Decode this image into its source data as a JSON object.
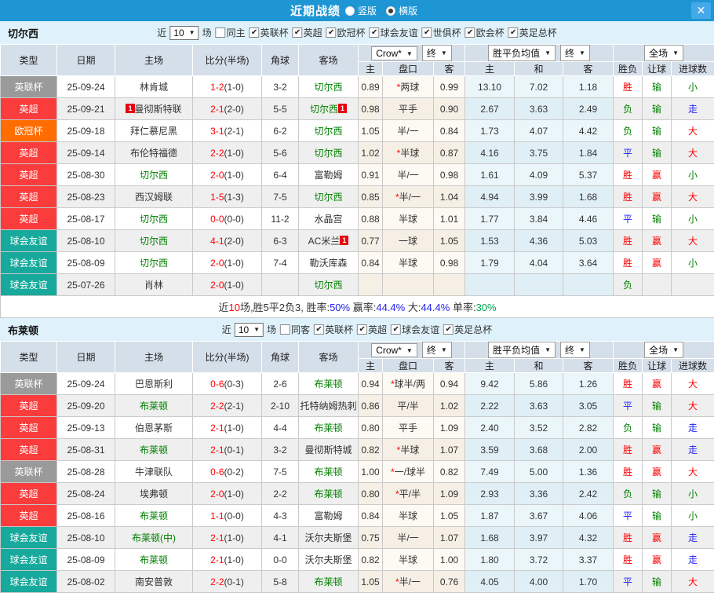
{
  "titlebar": {
    "title": "近期战绩",
    "radio_vertical": "竖版",
    "radio_horizontal": "横版",
    "selected_layout": "横版",
    "close_label": "X"
  },
  "colors": {
    "titlebar_bg": "#1E96D3",
    "focus_team": "#008000",
    "score": "#FF0000",
    "league": {
      "英联杯": "#9A9A9A",
      "英超": "#FB3C3C",
      "欧冠杯": "#FF6D00",
      "球会友谊": "#16A99C"
    },
    "result": {
      "胜": "#FF0000",
      "平": "#1F1FFF",
      "负": "#008000",
      "赢": "#FF0000",
      "输": "#008000",
      "大": "#FF0000",
      "小": "#008000",
      "走": "#1F1FFF"
    }
  },
  "table_labels": {
    "left_headers": [
      "类型",
      "日期",
      "主场",
      "比分(半场)",
      "角球",
      "客场"
    ],
    "odds_subheaders": [
      "主",
      "盘口",
      "客"
    ],
    "avg_subheaders": [
      "主",
      "和",
      "客"
    ],
    "result_subheaders": [
      "胜负",
      "让球",
      "进球数"
    ],
    "dropdown_crow": "Crow*",
    "dropdown_final1": "终",
    "dropdown_avg": "胜平负均值",
    "dropdown_final2": "终",
    "dropdown_scope": "全场"
  },
  "filter_labels": {
    "near": "近",
    "games": "场"
  },
  "sections": [
    {
      "team": "切尔西",
      "filter": {
        "count": "10",
        "same_label": "同主",
        "same_checked": false,
        "leagues": [
          "英联杯",
          "英超",
          "欧冠杯",
          "球会友谊",
          "世俱杯",
          "欧会杯",
          "英足总杯"
        ]
      },
      "rows": [
        {
          "league": "英联杯",
          "date": "25-09-24",
          "home": "林肯城",
          "home_focus": false,
          "home_badge": "",
          "score": "1-2",
          "half": "(1-0)",
          "corner": "3-2",
          "away": "切尔西",
          "away_focus": true,
          "away_badge": "",
          "odds_home": "0.89",
          "pan": "*两球",
          "odds_away": "0.99",
          "avg_win": "13.10",
          "avg_draw": "7.02",
          "avg_lose": "1.18",
          "res": "胜",
          "res_pan": "输",
          "res_goal": "小"
        },
        {
          "league": "英超",
          "date": "25-09-21",
          "home": "曼彻斯特联",
          "home_focus": false,
          "home_badge": "1",
          "score": "2-1",
          "half": "(2-0)",
          "corner": "5-5",
          "away": "切尔西",
          "away_focus": true,
          "away_badge": "1",
          "odds_home": "0.98",
          "pan": "平手",
          "odds_away": "0.90",
          "avg_win": "2.67",
          "avg_draw": "3.63",
          "avg_lose": "2.49",
          "res": "负",
          "res_pan": "输",
          "res_goal": "走"
        },
        {
          "league": "欧冠杯",
          "date": "25-09-18",
          "home": "拜仁慕尼黑",
          "home_focus": false,
          "home_badge": "",
          "score": "3-1",
          "half": "(2-1)",
          "corner": "6-2",
          "away": "切尔西",
          "away_focus": true,
          "away_badge": "",
          "odds_home": "1.05",
          "pan": "半/一",
          "odds_away": "0.84",
          "avg_win": "1.73",
          "avg_draw": "4.07",
          "avg_lose": "4.42",
          "res": "负",
          "res_pan": "输",
          "res_goal": "大"
        },
        {
          "league": "英超",
          "date": "25-09-14",
          "home": "布伦特福德",
          "home_focus": false,
          "home_badge": "",
          "score": "2-2",
          "half": "(1-0)",
          "corner": "5-6",
          "away": "切尔西",
          "away_focus": true,
          "away_badge": "",
          "odds_home": "1.02",
          "pan": "*半球",
          "odds_away": "0.87",
          "avg_win": "4.16",
          "avg_draw": "3.75",
          "avg_lose": "1.84",
          "res": "平",
          "res_pan": "输",
          "res_goal": "大"
        },
        {
          "league": "英超",
          "date": "25-08-30",
          "home": "切尔西",
          "home_focus": true,
          "home_badge": "",
          "score": "2-0",
          "half": "(1-0)",
          "corner": "6-4",
          "away": "富勒姆",
          "away_focus": false,
          "away_badge": "",
          "odds_home": "0.91",
          "pan": "半/一",
          "odds_away": "0.98",
          "avg_win": "1.61",
          "avg_draw": "4.09",
          "avg_lose": "5.37",
          "res": "胜",
          "res_pan": "赢",
          "res_goal": "小"
        },
        {
          "league": "英超",
          "date": "25-08-23",
          "home": "西汉姆联",
          "home_focus": false,
          "home_badge": "",
          "score": "1-5",
          "half": "(1-3)",
          "corner": "7-5",
          "away": "切尔西",
          "away_focus": true,
          "away_badge": "",
          "odds_home": "0.85",
          "pan": "*半/一",
          "odds_away": "1.04",
          "avg_win": "4.94",
          "avg_draw": "3.99",
          "avg_lose": "1.68",
          "res": "胜",
          "res_pan": "赢",
          "res_goal": "大"
        },
        {
          "league": "英超",
          "date": "25-08-17",
          "home": "切尔西",
          "home_focus": true,
          "home_badge": "",
          "score": "0-0",
          "half": "(0-0)",
          "corner": "11-2",
          "away": "水晶宫",
          "away_focus": false,
          "away_badge": "",
          "odds_home": "0.88",
          "pan": "半球",
          "odds_away": "1.01",
          "avg_win": "1.77",
          "avg_draw": "3.84",
          "avg_lose": "4.46",
          "res": "平",
          "res_pan": "输",
          "res_goal": "小"
        },
        {
          "league": "球会友谊",
          "date": "25-08-10",
          "home": "切尔西",
          "home_focus": true,
          "home_badge": "",
          "score": "4-1",
          "half": "(2-0)",
          "corner": "6-3",
          "away": "AC米兰",
          "away_focus": false,
          "away_badge": "1",
          "odds_home": "0.77",
          "pan": "一球",
          "odds_away": "1.05",
          "avg_win": "1.53",
          "avg_draw": "4.36",
          "avg_lose": "5.03",
          "res": "胜",
          "res_pan": "赢",
          "res_goal": "大"
        },
        {
          "league": "球会友谊",
          "date": "25-08-09",
          "home": "切尔西",
          "home_focus": true,
          "home_badge": "",
          "score": "2-0",
          "half": "(1-0)",
          "corner": "7-4",
          "away": "勒沃库森",
          "away_focus": false,
          "away_badge": "",
          "odds_home": "0.84",
          "pan": "半球",
          "odds_away": "0.98",
          "avg_win": "1.79",
          "avg_draw": "4.04",
          "avg_lose": "3.64",
          "res": "胜",
          "res_pan": "赢",
          "res_goal": "小"
        },
        {
          "league": "球会友谊",
          "date": "25-07-26",
          "home": "肖林",
          "home_focus": false,
          "home_badge": "",
          "score": "2-0",
          "half": "(1-0)",
          "corner": "",
          "away": "切尔西",
          "away_focus": true,
          "away_badge": "",
          "odds_home": "",
          "pan": "",
          "odds_away": "",
          "avg_win": "",
          "avg_draw": "",
          "avg_lose": "",
          "res": "负",
          "res_pan": "",
          "res_goal": ""
        }
      ],
      "summary": [
        {
          "t": "近",
          "c": "#333333"
        },
        {
          "t": "10",
          "c": "#FF0000"
        },
        {
          "t": "场,胜5平2负3, 胜率:",
          "c": "#333333"
        },
        {
          "t": "50%",
          "c": "#2222EE"
        },
        {
          "t": " 赢率:",
          "c": "#333333"
        },
        {
          "t": "44.4%",
          "c": "#2222EE"
        },
        {
          "t": " 大:",
          "c": "#333333"
        },
        {
          "t": "44.4%",
          "c": "#2222EE"
        },
        {
          "t": " 单率:",
          "c": "#333333"
        },
        {
          "t": "30%",
          "c": "#00A651"
        }
      ]
    },
    {
      "team": "布莱顿",
      "filter": {
        "count": "10",
        "same_label": "同客",
        "same_checked": false,
        "leagues": [
          "英联杯",
          "英超",
          "球会友谊",
          "英足总杯"
        ]
      },
      "rows": [
        {
          "league": "英联杯",
          "date": "25-09-24",
          "home": "巴恩斯利",
          "home_focus": false,
          "home_badge": "",
          "score": "0-6",
          "half": "(0-3)",
          "corner": "2-6",
          "away": "布莱顿",
          "away_focus": true,
          "away_badge": "",
          "odds_home": "0.94",
          "pan": "*球半/两",
          "odds_away": "0.94",
          "avg_win": "9.42",
          "avg_draw": "5.86",
          "avg_lose": "1.26",
          "res": "胜",
          "res_pan": "赢",
          "res_goal": "大"
        },
        {
          "league": "英超",
          "date": "25-09-20",
          "home": "布莱顿",
          "home_focus": true,
          "home_badge": "",
          "score": "2-2",
          "half": "(2-1)",
          "corner": "2-10",
          "away": "托特纳姆热刺",
          "away_focus": false,
          "away_badge": "",
          "odds_home": "0.86",
          "pan": "平/半",
          "odds_away": "1.02",
          "avg_win": "2.22",
          "avg_draw": "3.63",
          "avg_lose": "3.05",
          "res": "平",
          "res_pan": "输",
          "res_goal": "大"
        },
        {
          "league": "英超",
          "date": "25-09-13",
          "home": "伯恩茅斯",
          "home_focus": false,
          "home_badge": "",
          "score": "2-1",
          "half": "(1-0)",
          "corner": "4-4",
          "away": "布莱顿",
          "away_focus": true,
          "away_badge": "",
          "odds_home": "0.80",
          "pan": "平手",
          "odds_away": "1.09",
          "avg_win": "2.40",
          "avg_draw": "3.52",
          "avg_lose": "2.82",
          "res": "负",
          "res_pan": "输",
          "res_goal": "走"
        },
        {
          "league": "英超",
          "date": "25-08-31",
          "home": "布莱顿",
          "home_focus": true,
          "home_badge": "",
          "score": "2-1",
          "half": "(0-1)",
          "corner": "3-2",
          "away": "曼彻斯特城",
          "away_focus": false,
          "away_badge": "",
          "odds_home": "0.82",
          "pan": "*半球",
          "odds_away": "1.07",
          "avg_win": "3.59",
          "avg_draw": "3.68",
          "avg_lose": "2.00",
          "res": "胜",
          "res_pan": "赢",
          "res_goal": "走"
        },
        {
          "league": "英联杯",
          "date": "25-08-28",
          "home": "牛津联队",
          "home_focus": false,
          "home_badge": "",
          "score": "0-6",
          "half": "(0-2)",
          "corner": "7-5",
          "away": "布莱顿",
          "away_focus": true,
          "away_badge": "",
          "odds_home": "1.00",
          "pan": "*一/球半",
          "odds_away": "0.82",
          "avg_win": "7.49",
          "avg_draw": "5.00",
          "avg_lose": "1.36",
          "res": "胜",
          "res_pan": "赢",
          "res_goal": "大"
        },
        {
          "league": "英超",
          "date": "25-08-24",
          "home": "埃弗顿",
          "home_focus": false,
          "home_badge": "",
          "score": "2-0",
          "half": "(1-0)",
          "corner": "2-2",
          "away": "布莱顿",
          "away_focus": true,
          "away_badge": "",
          "odds_home": "0.80",
          "pan": "*平/半",
          "odds_away": "1.09",
          "avg_win": "2.93",
          "avg_draw": "3.36",
          "avg_lose": "2.42",
          "res": "负",
          "res_pan": "输",
          "res_goal": "小"
        },
        {
          "league": "英超",
          "date": "25-08-16",
          "home": "布莱顿",
          "home_focus": true,
          "home_badge": "",
          "score": "1-1",
          "half": "(0-0)",
          "corner": "4-3",
          "away": "富勒姆",
          "away_focus": false,
          "away_badge": "",
          "odds_home": "0.84",
          "pan": "半球",
          "odds_away": "1.05",
          "avg_win": "1.87",
          "avg_draw": "3.67",
          "avg_lose": "4.06",
          "res": "平",
          "res_pan": "输",
          "res_goal": "小"
        },
        {
          "league": "球会友谊",
          "date": "25-08-10",
          "home": "布莱顿(中)",
          "home_focus": true,
          "home_badge": "",
          "score": "2-1",
          "half": "(1-0)",
          "corner": "4-1",
          "away": "沃尔夫斯堡",
          "away_focus": false,
          "away_badge": "",
          "odds_home": "0.75",
          "pan": "半/一",
          "odds_away": "1.07",
          "avg_win": "1.68",
          "avg_draw": "3.97",
          "avg_lose": "4.32",
          "res": "胜",
          "res_pan": "赢",
          "res_goal": "走"
        },
        {
          "league": "球会友谊",
          "date": "25-08-09",
          "home": "布莱顿",
          "home_focus": true,
          "home_badge": "",
          "score": "2-1",
          "half": "(1-0)",
          "corner": "0-0",
          "away": "沃尔夫斯堡",
          "away_focus": false,
          "away_badge": "",
          "odds_home": "0.82",
          "pan": "半球",
          "odds_away": "1.00",
          "avg_win": "1.80",
          "avg_draw": "3.72",
          "avg_lose": "3.37",
          "res": "胜",
          "res_pan": "赢",
          "res_goal": "走"
        },
        {
          "league": "球会友谊",
          "date": "25-08-02",
          "home": "南安普敦",
          "home_focus": false,
          "home_badge": "",
          "score": "2-2",
          "half": "(0-1)",
          "corner": "5-8",
          "away": "布莱顿",
          "away_focus": true,
          "away_badge": "",
          "odds_home": "1.05",
          "pan": "*半/一",
          "odds_away": "0.76",
          "avg_win": "4.05",
          "avg_draw": "4.00",
          "avg_lose": "1.70",
          "res": "平",
          "res_pan": "输",
          "res_goal": "大"
        }
      ],
      "summary": null
    }
  ]
}
